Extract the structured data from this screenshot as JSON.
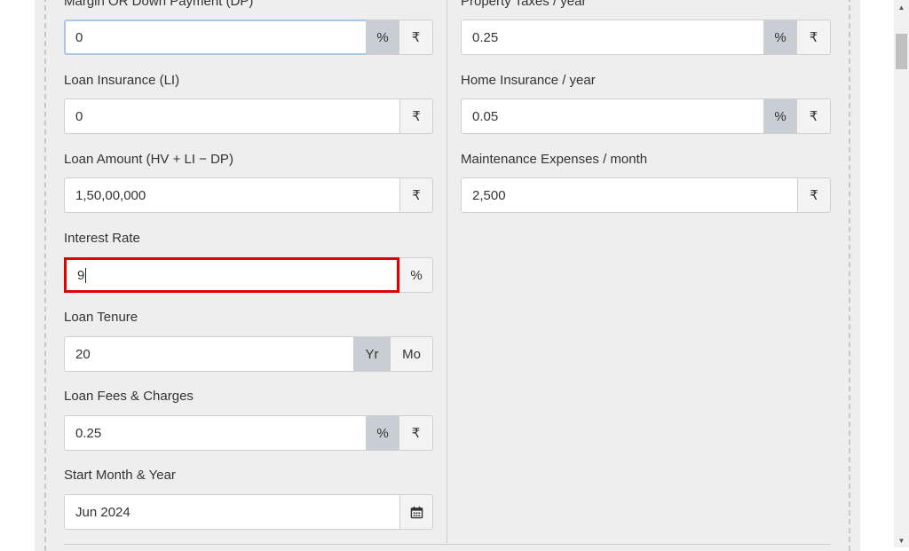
{
  "left": {
    "down_payment": {
      "label": "Margin OR Down Payment (DP)",
      "value": "0",
      "unit1": "%",
      "unit2": "₹"
    },
    "loan_insurance": {
      "label": "Loan Insurance (LI)",
      "value": "0",
      "unit": "₹"
    },
    "loan_amount": {
      "label": "Loan Amount (HV + LI − DP)",
      "value": "1,50,00,000",
      "unit": "₹"
    },
    "interest_rate": {
      "label": "Interest Rate",
      "value": "9",
      "unit": "%"
    },
    "loan_tenure": {
      "label": "Loan Tenure",
      "value": "20",
      "unit1": "Yr",
      "unit2": "Mo"
    },
    "loan_fees": {
      "label": "Loan Fees & Charges",
      "value": "0.25",
      "unit1": "%",
      "unit2": "₹"
    },
    "start_month": {
      "label": "Start Month & Year",
      "value": "Jun 2024"
    }
  },
  "right": {
    "property_taxes": {
      "label": "Property Taxes / year",
      "value": "0.25",
      "unit1": "%",
      "unit2": "₹"
    },
    "home_insurance": {
      "label": "Home Insurance / year",
      "value": "0.05",
      "unit1": "%",
      "unit2": "₹"
    },
    "maintenance": {
      "label": "Maintenance Expenses / month",
      "value": "2,500",
      "unit": "₹"
    }
  },
  "icons": {
    "calendar": "calendar-icon",
    "scroll_up": "scroll-up-arrow",
    "scroll_down": "scroll-down-arrow"
  },
  "colors": {
    "active_addon": "#c9ced5",
    "highlight": "#e00000",
    "focus": "#a9c7e8"
  }
}
